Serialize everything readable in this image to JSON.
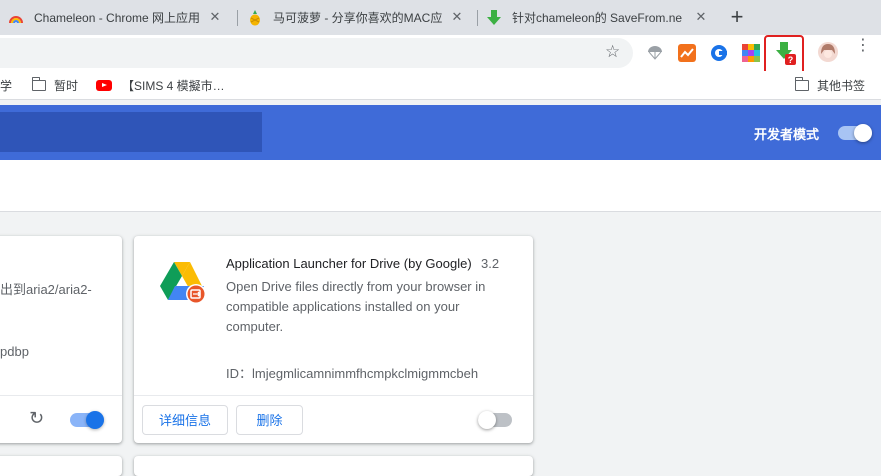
{
  "tabs": [
    {
      "title": "Chameleon - Chrome 网上应用",
      "favicon": "rainbow-icon"
    },
    {
      "title": "马可菠萝 - 分享你喜欢的MAC应",
      "favicon": "pineapple-icon"
    },
    {
      "title": "针对chameleon的 SaveFrom.ne",
      "favicon": "savefrom-icon"
    }
  ],
  "tab_close_glyph": "✕",
  "new_tab_glyph": "+",
  "toolbar": {
    "star_glyph": "☆",
    "menu_glyph": "⋮",
    "extension_icons": [
      "parachute-icon",
      "chart-icon",
      "edge-icon",
      "colorgrid-icon",
      "savefrom-extension-icon",
      "avatar-icon"
    ],
    "badge_text": "?"
  },
  "bookmarks": {
    "items": [
      {
        "label": "学",
        "icon": "none"
      },
      {
        "label": "暂时",
        "icon": "folder-icon"
      },
      {
        "label": "【SIMS 4 模擬市…",
        "icon": "youtube-icon"
      }
    ],
    "other": "其他书签"
  },
  "header": {
    "dev_mode_label": "开发者模式",
    "dev_mode_on": true
  },
  "left_card": {
    "desc_fragment": "出到aria2/aria2-",
    "id_fragment": "pdbp",
    "reload_glyph": "↻",
    "enabled": true
  },
  "main_card": {
    "name": "Application Launcher for Drive (by Google)",
    "version": "3.2",
    "description": "Open Drive files directly from your browser in compatible applications installed on your computer.",
    "id_label": "ID：",
    "id_value": "lmjegmlicamnimmfhcmpkclmigmmcbeh",
    "details_label": "详细信息",
    "remove_label": "删除",
    "enabled": false
  },
  "colors": {
    "accent": "#1a73e8",
    "header_bg": "#3f6bd8",
    "highlight": "#e02020"
  }
}
